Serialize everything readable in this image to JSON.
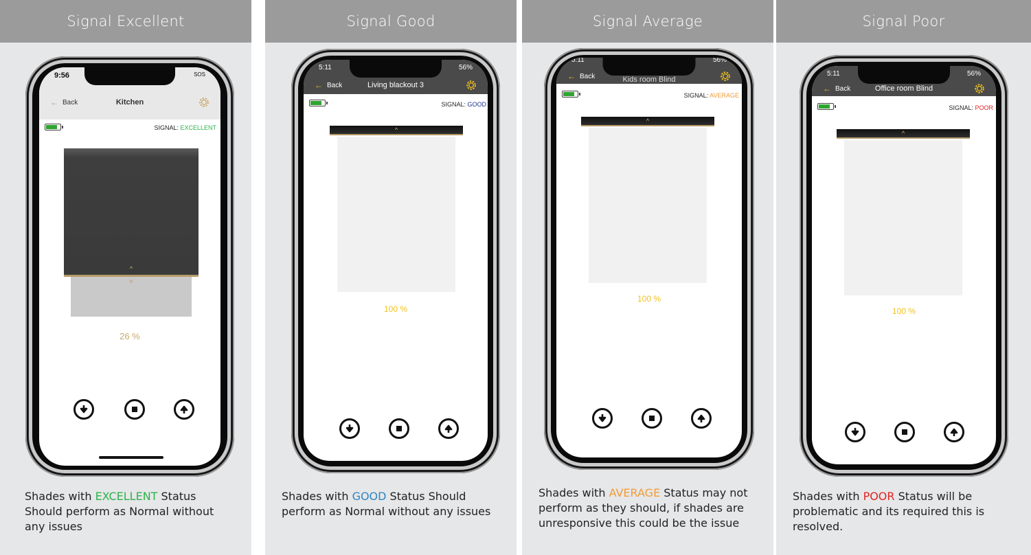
{
  "colors": {
    "header_bg": "#9b9b9b",
    "card_bg": "#e6e7e8",
    "excellent": "#2bb34a",
    "good": "#2e86c1",
    "average": "#f29b38",
    "poor": "#e02424",
    "percent_gold": "#c9a86a",
    "percent_yellow": "#f2c21b"
  },
  "panels": [
    {
      "header": "Signal Excellent",
      "phone": {
        "time": "9:56",
        "status_right": "SOS",
        "back": "Back",
        "title": "Kitchen",
        "signal_label": "SIGNAL:",
        "signal_value": "EXCELLENT",
        "position_percent": "26 %",
        "shade_closed_fraction": 0.74
      },
      "desc_pre": "Shades with ",
      "desc_status": "EXCELLENT",
      "desc_post": " Status Should perform as Normal without any issues"
    },
    {
      "header": "Signal Good",
      "phone": {
        "time": "5:11",
        "status_right": "56%",
        "back": "Back",
        "title": "Living blackout 3",
        "signal_label": "SIGNAL:",
        "signal_value": "GOOD",
        "position_percent": "100 %"
      },
      "desc_pre": "Shades with ",
      "desc_status": "GOOD",
      "desc_post": " Status Should perform as Normal without any issues"
    },
    {
      "header": "Signal Average",
      "phone": {
        "time": "5:11",
        "status_right": "56%",
        "back": "Back",
        "title": "Kids room Blind",
        "signal_label": "SIGNAL:",
        "signal_value": "AVERAGE",
        "position_percent": "100 %"
      },
      "desc_pre": "Shades with ",
      "desc_status": "AVERAGE",
      "desc_post": " Status may not perform as they should, if shades are unresponsive this could be the issue"
    },
    {
      "header": "Signal Poor",
      "phone": {
        "time": "5:11",
        "status_right": "56%",
        "back": "Back",
        "title": "Office room Blind",
        "signal_label": "SIGNAL:",
        "signal_value": "POOR",
        "position_percent": "100 %"
      },
      "desc_pre": "Shades with ",
      "desc_status": "POOR",
      "desc_post": " Status will be problematic and its required this is resolved."
    }
  ],
  "icons": {
    "down": "arrow-down-circle-icon",
    "stop": "stop-circle-icon",
    "up": "arrow-up-circle-icon",
    "gear": "gear-icon",
    "back": "arrow-left-icon",
    "battery": "battery-icon"
  }
}
